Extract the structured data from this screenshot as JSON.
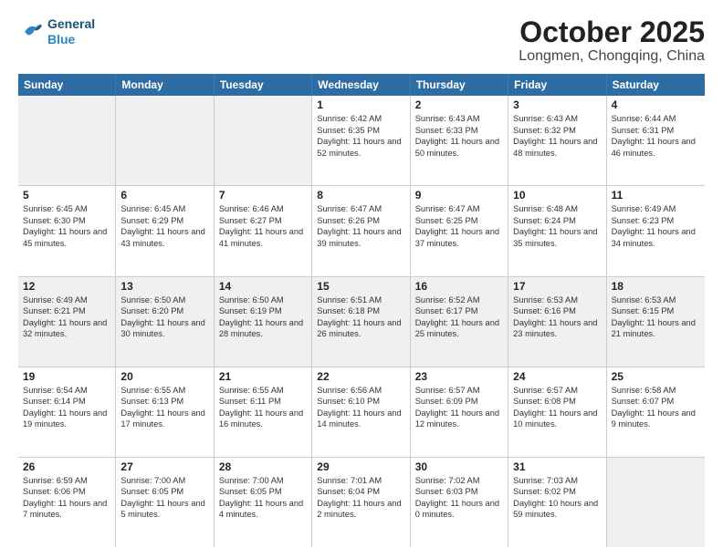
{
  "header": {
    "logo_line1": "General",
    "logo_line2": "Blue",
    "month": "October 2025",
    "location": "Longmen, Chongqing, China"
  },
  "weekdays": [
    "Sunday",
    "Monday",
    "Tuesday",
    "Wednesday",
    "Thursday",
    "Friday",
    "Saturday"
  ],
  "rows": [
    [
      {
        "day": "",
        "sunrise": "",
        "sunset": "",
        "daylight": ""
      },
      {
        "day": "",
        "sunrise": "",
        "sunset": "",
        "daylight": ""
      },
      {
        "day": "",
        "sunrise": "",
        "sunset": "",
        "daylight": ""
      },
      {
        "day": "1",
        "sunrise": "Sunrise: 6:42 AM",
        "sunset": "Sunset: 6:35 PM",
        "daylight": "Daylight: 11 hours and 52 minutes."
      },
      {
        "day": "2",
        "sunrise": "Sunrise: 6:43 AM",
        "sunset": "Sunset: 6:33 PM",
        "daylight": "Daylight: 11 hours and 50 minutes."
      },
      {
        "day": "3",
        "sunrise": "Sunrise: 6:43 AM",
        "sunset": "Sunset: 6:32 PM",
        "daylight": "Daylight: 11 hours and 48 minutes."
      },
      {
        "day": "4",
        "sunrise": "Sunrise: 6:44 AM",
        "sunset": "Sunset: 6:31 PM",
        "daylight": "Daylight: 11 hours and 46 minutes."
      }
    ],
    [
      {
        "day": "5",
        "sunrise": "Sunrise: 6:45 AM",
        "sunset": "Sunset: 6:30 PM",
        "daylight": "Daylight: 11 hours and 45 minutes."
      },
      {
        "day": "6",
        "sunrise": "Sunrise: 6:45 AM",
        "sunset": "Sunset: 6:29 PM",
        "daylight": "Daylight: 11 hours and 43 minutes."
      },
      {
        "day": "7",
        "sunrise": "Sunrise: 6:46 AM",
        "sunset": "Sunset: 6:27 PM",
        "daylight": "Daylight: 11 hours and 41 minutes."
      },
      {
        "day": "8",
        "sunrise": "Sunrise: 6:47 AM",
        "sunset": "Sunset: 6:26 PM",
        "daylight": "Daylight: 11 hours and 39 minutes."
      },
      {
        "day": "9",
        "sunrise": "Sunrise: 6:47 AM",
        "sunset": "Sunset: 6:25 PM",
        "daylight": "Daylight: 11 hours and 37 minutes."
      },
      {
        "day": "10",
        "sunrise": "Sunrise: 6:48 AM",
        "sunset": "Sunset: 6:24 PM",
        "daylight": "Daylight: 11 hours and 35 minutes."
      },
      {
        "day": "11",
        "sunrise": "Sunrise: 6:49 AM",
        "sunset": "Sunset: 6:23 PM",
        "daylight": "Daylight: 11 hours and 34 minutes."
      }
    ],
    [
      {
        "day": "12",
        "sunrise": "Sunrise: 6:49 AM",
        "sunset": "Sunset: 6:21 PM",
        "daylight": "Daylight: 11 hours and 32 minutes."
      },
      {
        "day": "13",
        "sunrise": "Sunrise: 6:50 AM",
        "sunset": "Sunset: 6:20 PM",
        "daylight": "Daylight: 11 hours and 30 minutes."
      },
      {
        "day": "14",
        "sunrise": "Sunrise: 6:50 AM",
        "sunset": "Sunset: 6:19 PM",
        "daylight": "Daylight: 11 hours and 28 minutes."
      },
      {
        "day": "15",
        "sunrise": "Sunrise: 6:51 AM",
        "sunset": "Sunset: 6:18 PM",
        "daylight": "Daylight: 11 hours and 26 minutes."
      },
      {
        "day": "16",
        "sunrise": "Sunrise: 6:52 AM",
        "sunset": "Sunset: 6:17 PM",
        "daylight": "Daylight: 11 hours and 25 minutes."
      },
      {
        "day": "17",
        "sunrise": "Sunrise: 6:53 AM",
        "sunset": "Sunset: 6:16 PM",
        "daylight": "Daylight: 11 hours and 23 minutes."
      },
      {
        "day": "18",
        "sunrise": "Sunrise: 6:53 AM",
        "sunset": "Sunset: 6:15 PM",
        "daylight": "Daylight: 11 hours and 21 minutes."
      }
    ],
    [
      {
        "day": "19",
        "sunrise": "Sunrise: 6:54 AM",
        "sunset": "Sunset: 6:14 PM",
        "daylight": "Daylight: 11 hours and 19 minutes."
      },
      {
        "day": "20",
        "sunrise": "Sunrise: 6:55 AM",
        "sunset": "Sunset: 6:13 PM",
        "daylight": "Daylight: 11 hours and 17 minutes."
      },
      {
        "day": "21",
        "sunrise": "Sunrise: 6:55 AM",
        "sunset": "Sunset: 6:11 PM",
        "daylight": "Daylight: 11 hours and 16 minutes."
      },
      {
        "day": "22",
        "sunrise": "Sunrise: 6:56 AM",
        "sunset": "Sunset: 6:10 PM",
        "daylight": "Daylight: 11 hours and 14 minutes."
      },
      {
        "day": "23",
        "sunrise": "Sunrise: 6:57 AM",
        "sunset": "Sunset: 6:09 PM",
        "daylight": "Daylight: 11 hours and 12 minutes."
      },
      {
        "day": "24",
        "sunrise": "Sunrise: 6:57 AM",
        "sunset": "Sunset: 6:08 PM",
        "daylight": "Daylight: 11 hours and 10 minutes."
      },
      {
        "day": "25",
        "sunrise": "Sunrise: 6:58 AM",
        "sunset": "Sunset: 6:07 PM",
        "daylight": "Daylight: 11 hours and 9 minutes."
      }
    ],
    [
      {
        "day": "26",
        "sunrise": "Sunrise: 6:59 AM",
        "sunset": "Sunset: 6:06 PM",
        "daylight": "Daylight: 11 hours and 7 minutes."
      },
      {
        "day": "27",
        "sunrise": "Sunrise: 7:00 AM",
        "sunset": "Sunset: 6:05 PM",
        "daylight": "Daylight: 11 hours and 5 minutes."
      },
      {
        "day": "28",
        "sunrise": "Sunrise: 7:00 AM",
        "sunset": "Sunset: 6:05 PM",
        "daylight": "Daylight: 11 hours and 4 minutes."
      },
      {
        "day": "29",
        "sunrise": "Sunrise: 7:01 AM",
        "sunset": "Sunset: 6:04 PM",
        "daylight": "Daylight: 11 hours and 2 minutes."
      },
      {
        "day": "30",
        "sunrise": "Sunrise: 7:02 AM",
        "sunset": "Sunset: 6:03 PM",
        "daylight": "Daylight: 11 hours and 0 minutes."
      },
      {
        "day": "31",
        "sunrise": "Sunrise: 7:03 AM",
        "sunset": "Sunset: 6:02 PM",
        "daylight": "Daylight: 10 hours and 59 minutes."
      },
      {
        "day": "",
        "sunrise": "",
        "sunset": "",
        "daylight": ""
      }
    ]
  ],
  "shaded_rows": [
    0,
    2,
    4
  ],
  "shaded_cells_row0": [
    0,
    1,
    2
  ],
  "shaded_cells_row4": [
    6
  ]
}
